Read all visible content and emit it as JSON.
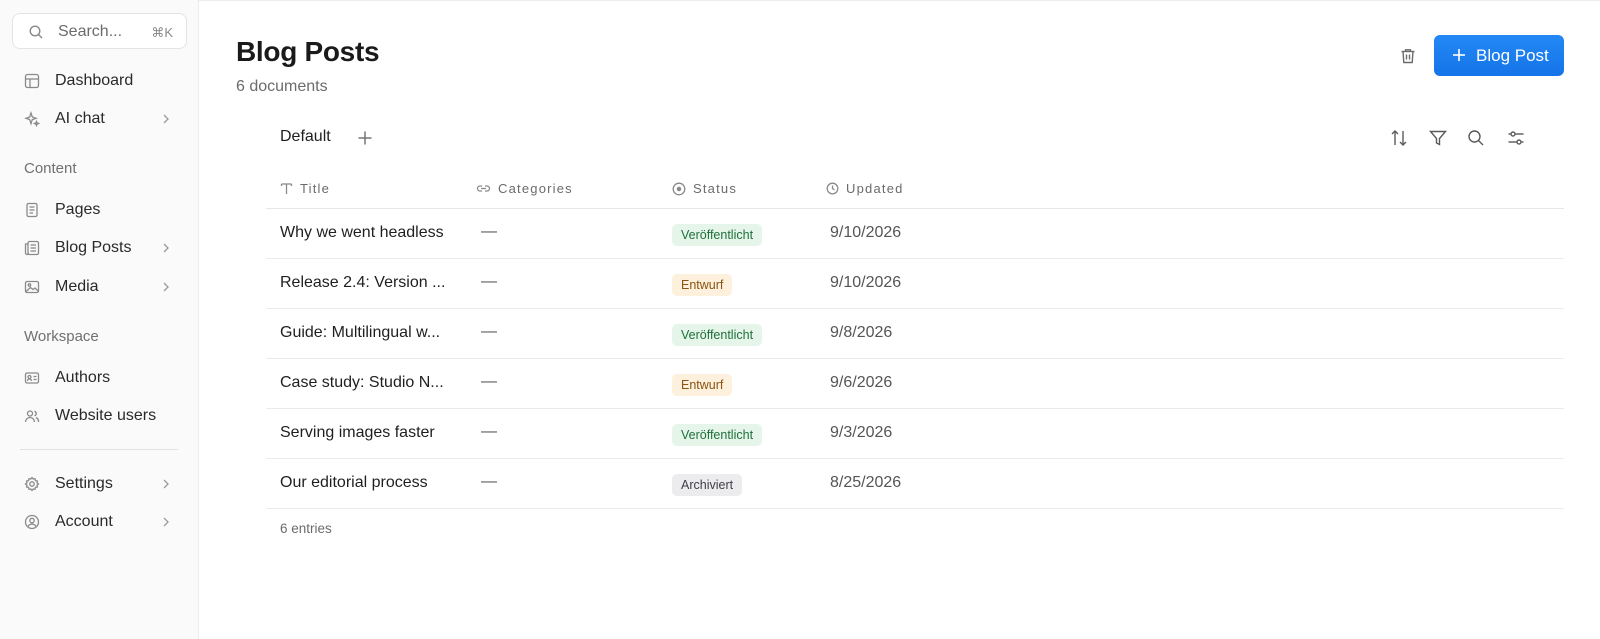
{
  "sidebar": {
    "search": {
      "placeholder": "Search...",
      "shortcut": "⌘K"
    },
    "items": [
      {
        "label": "Dashboard",
        "icon": "layout-icon"
      },
      {
        "label": "AI chat",
        "icon": "sparkles-icon"
      }
    ],
    "content_label": "Content",
    "content_items": [
      {
        "label": "Pages",
        "icon": "file-icon"
      },
      {
        "label": "Blog Posts",
        "icon": "newspaper-icon"
      },
      {
        "label": "Media",
        "icon": "image-icon"
      }
    ],
    "workspace_label": "Workspace",
    "workspace_items": [
      {
        "label": "Authors",
        "icon": "id-card-icon"
      },
      {
        "label": "Website users",
        "icon": "users-icon"
      }
    ],
    "bottom_items": [
      {
        "label": "Settings",
        "icon": "gear-icon"
      },
      {
        "label": "Account",
        "icon": "user-circle-icon"
      }
    ]
  },
  "header": {
    "title": "Blog Posts",
    "subtitle": "6 documents",
    "new_button_label": "Blog Post",
    "accent_color": "#1a7df0"
  },
  "view": {
    "tab_label": "Default"
  },
  "table": {
    "columns": [
      "Title",
      "Categories",
      "Status",
      "Updated"
    ],
    "rows": [
      {
        "title": "Why we went headless",
        "categories": "—",
        "status": "Veröffentlicht",
        "updated": "9/10/2026"
      },
      {
        "title": "Release 2.4: Version ...",
        "categories": "—",
        "status": "Entwurf",
        "updated": "9/10/2026"
      },
      {
        "title": "Guide: Multilingual w...",
        "categories": "—",
        "status": "Veröffentlicht",
        "updated": "9/8/2026"
      },
      {
        "title": "Case study: Studio N...",
        "categories": "—",
        "status": "Entwurf",
        "updated": "9/6/2026"
      },
      {
        "title": "Serving images faster",
        "categories": "—",
        "status": "Veröffentlicht",
        "updated": "9/3/2026"
      },
      {
        "title": "Our editorial process",
        "categories": "—",
        "status": "Archiviert",
        "updated": "8/25/2026"
      }
    ],
    "footer": "6 entries"
  }
}
